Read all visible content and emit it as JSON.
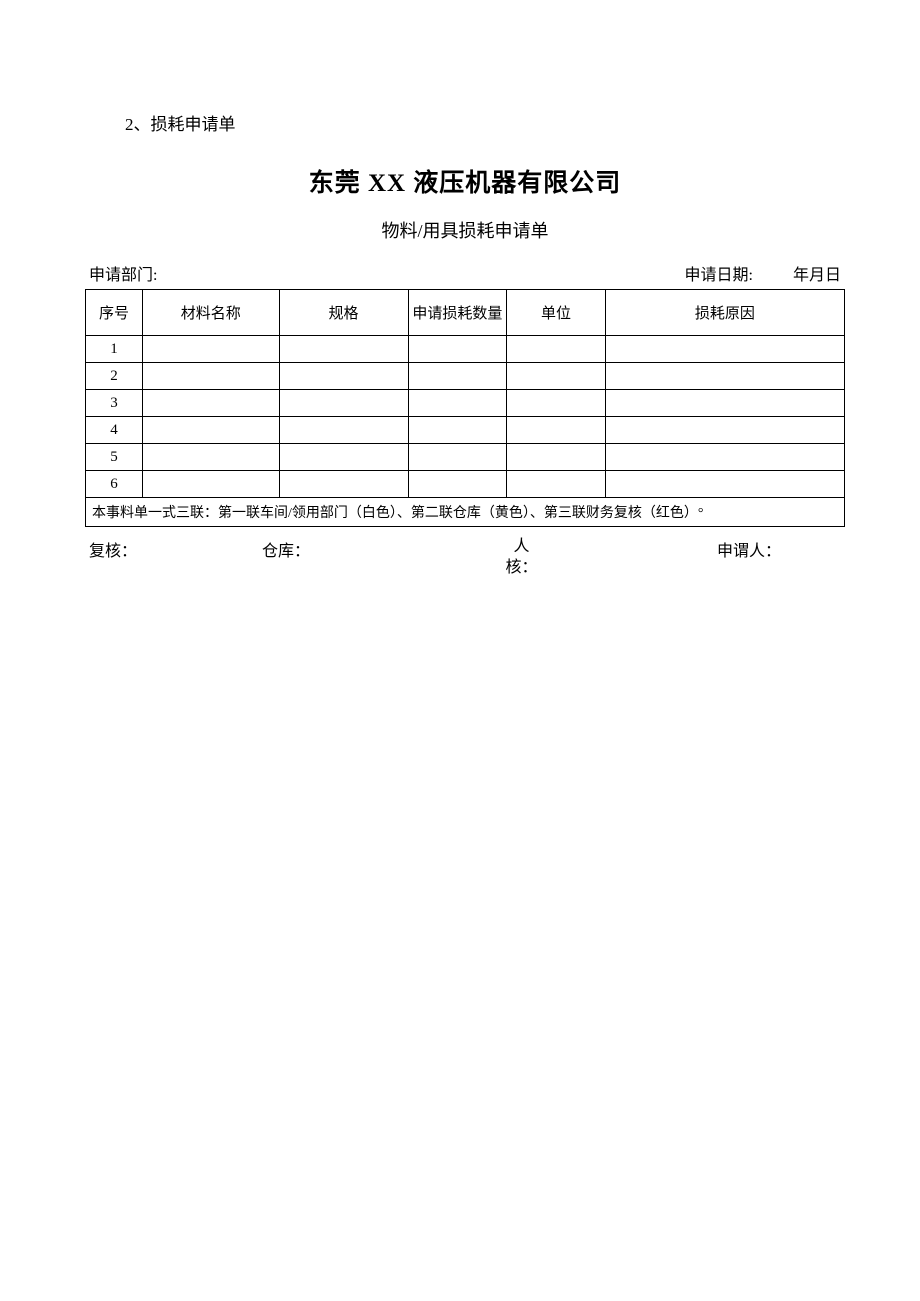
{
  "section_header": "2、损耗申请单",
  "company_title": "东莞 XX 液压机器有限公司",
  "form_title": "物料/用具损耗申请单",
  "top": {
    "dept_label": "申请部门:",
    "date_label": "申请日期:",
    "date_value": "年月日"
  },
  "headers": {
    "seq": "序号",
    "name": "材料名称",
    "spec": "规格",
    "qty": "申请损耗数量",
    "unit": "单位",
    "reason": "损耗原因"
  },
  "rows": [
    {
      "seq": "1",
      "name": "",
      "spec": "",
      "qty": "",
      "unit": "",
      "reason": ""
    },
    {
      "seq": "2",
      "name": "",
      "spec": "",
      "qty": "",
      "unit": "",
      "reason": ""
    },
    {
      "seq": "3",
      "name": "",
      "spec": "",
      "qty": "",
      "unit": "",
      "reason": ""
    },
    {
      "seq": "4",
      "name": "",
      "spec": "",
      "qty": "",
      "unit": "",
      "reason": ""
    },
    {
      "seq": "5",
      "name": "",
      "spec": "",
      "qty": "",
      "unit": "",
      "reason": ""
    },
    {
      "seq": "6",
      "name": "",
      "spec": "",
      "qty": "",
      "unit": "",
      "reason": ""
    }
  ],
  "footer_note": "本事料单一式三联：第一联车间/领用部门（白色）、第二联仓库（黄色）、第三联财务复核（红色）°",
  "bottom": {
    "review": "复核：",
    "warehouse": "仓库：",
    "check_line1": "人",
    "check_line2": "核：",
    "applicant": "申谓人："
  }
}
